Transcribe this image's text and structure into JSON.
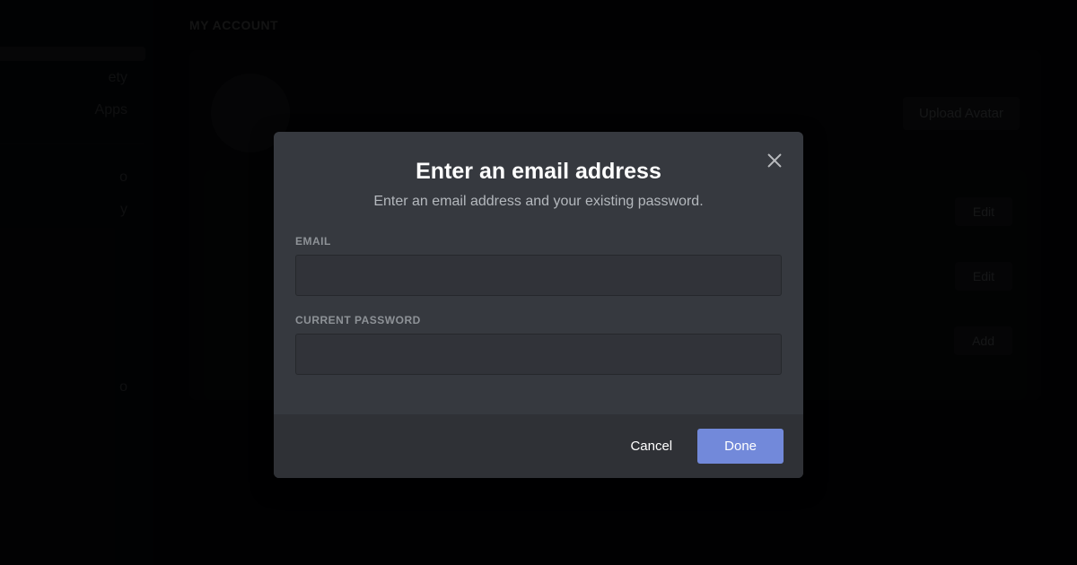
{
  "sidebar": {
    "items": [
      {
        "label": ""
      },
      {
        "label": "ety"
      },
      {
        "label": "Apps"
      },
      {
        "label": "o"
      },
      {
        "label": "y"
      },
      {
        "label": "o"
      }
    ]
  },
  "page": {
    "heading": "MY ACCOUNT"
  },
  "account_card": {
    "upload_avatar_label": "Upload Avatar",
    "rows": [
      {
        "action": "Edit"
      },
      {
        "action": "Edit"
      },
      {
        "action": "Add"
      }
    ]
  },
  "modal": {
    "title": "Enter an email address",
    "subtitle": "Enter an email address and your existing password.",
    "email_label": "EMAIL",
    "email_value": "",
    "password_label": "CURRENT PASSWORD",
    "password_value": "",
    "cancel_label": "Cancel",
    "done_label": "Done"
  },
  "colors": {
    "accent": "#7289da",
    "modal_bg": "#36393f",
    "footer_bg": "#2f3136"
  }
}
